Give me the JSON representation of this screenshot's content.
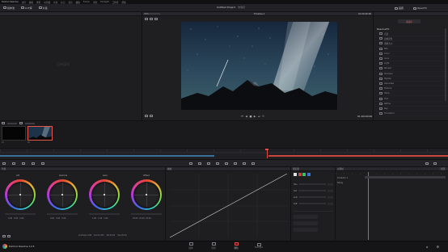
{
  "menubar": {
    "app": "DaVinci Resolve",
    "items": [
      "文件",
      "编辑",
      "修剪",
      "时间线",
      "片段",
      "标记",
      "显示",
      "播放",
      "Fusion",
      "调色",
      "Fairlight",
      "工作区",
      "帮助"
    ]
  },
  "toolbar": {
    "media_pool": "媒体池",
    "lut": "LUT库",
    "clips": "片段",
    "project_title": "Untitled Project",
    "project_status": "未保存",
    "gallery": "画廊",
    "openfx": "OpenFX",
    "viewer_clip_name": "Timeline 1",
    "viewer_zoom": "37%"
  },
  "mediapool": {
    "empty_text": "没有媒体"
  },
  "viewer": {
    "timecode_left": "01:00:00:00",
    "timecode_right": "01:00:26:00"
  },
  "fx": {
    "tab": "素材库",
    "header": "ResolveFX",
    "items": [
      "亮度",
      "边角定位",
      "调整大小",
      "Blur",
      "Color",
      "Lens",
      "Light",
      "Reveal",
      "Sharpen",
      "Stylize",
      "Generate",
      "Texture",
      "Warp",
      "Film",
      "Refine",
      "Key",
      "Transform"
    ]
  },
  "clips": [
    {
      "label": "01",
      "tc": "01:00:00:00"
    },
    {
      "label": "02",
      "tc": "01:00:10:12"
    }
  ],
  "color": {
    "wheels_title": "色轮",
    "wheels": [
      {
        "name": "Lift",
        "rgb": [
          "0.00",
          "0.00",
          "0.00"
        ]
      },
      {
        "name": "Gamma",
        "rgb": [
          "0.00",
          "0.00",
          "0.00"
        ]
      },
      {
        "name": "Gain",
        "rgb": [
          "1.00",
          "1.00",
          "1.00"
        ]
      },
      {
        "name": "Offset",
        "rgb": [
          "25.00",
          "25.00",
          "25.00"
        ]
      }
    ],
    "wheel_footer": [
      "Contrast 1.000",
      "Pivot 0.435",
      "Sat 50.00",
      "Hue 50.00",
      "Lum Mix 100.00"
    ],
    "curves_title": "曲线",
    "qualifier_title": "限定器",
    "qualifier_rows": [
      "Hue",
      "Sat",
      "Lum",
      "Soft"
    ],
    "keyframes_title": "关键帧",
    "keyframes_label": "全部",
    "keyframe_rows": [
      "Corrector 1",
      "Sizing"
    ]
  },
  "pages": {
    "logo_text": "DaVinci Resolve 12.5",
    "items": [
      "媒体",
      "剪辑",
      "调色",
      "Fairlight"
    ],
    "active_index": 2
  }
}
